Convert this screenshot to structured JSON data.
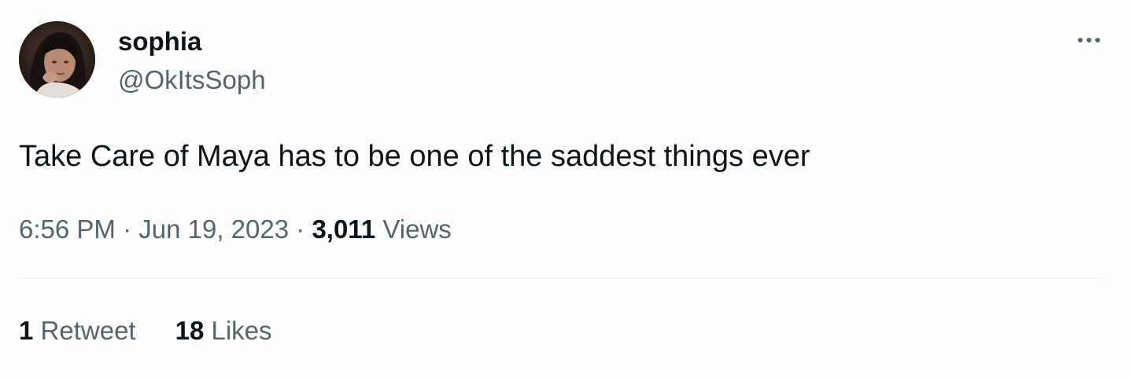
{
  "author": {
    "display_name": "sophia",
    "handle": "@OkItsSoph"
  },
  "tweet": {
    "text": "Take Care of Maya has to be one of the saddest things ever",
    "time": "6:56 PM",
    "separator": "·",
    "date": "Jun 19, 2023",
    "views_count": "3,011",
    "views_label": "Views"
  },
  "stats": {
    "retweets_count": "1",
    "retweets_label": "Retweet",
    "likes_count": "18",
    "likes_label": "Likes"
  },
  "icons": {
    "more": "more-horizontal-icon"
  },
  "colors": {
    "primary_text": "#0f1419",
    "secondary_text": "#536471",
    "divider": "#eff3f4",
    "background": "#fdfdfe"
  }
}
